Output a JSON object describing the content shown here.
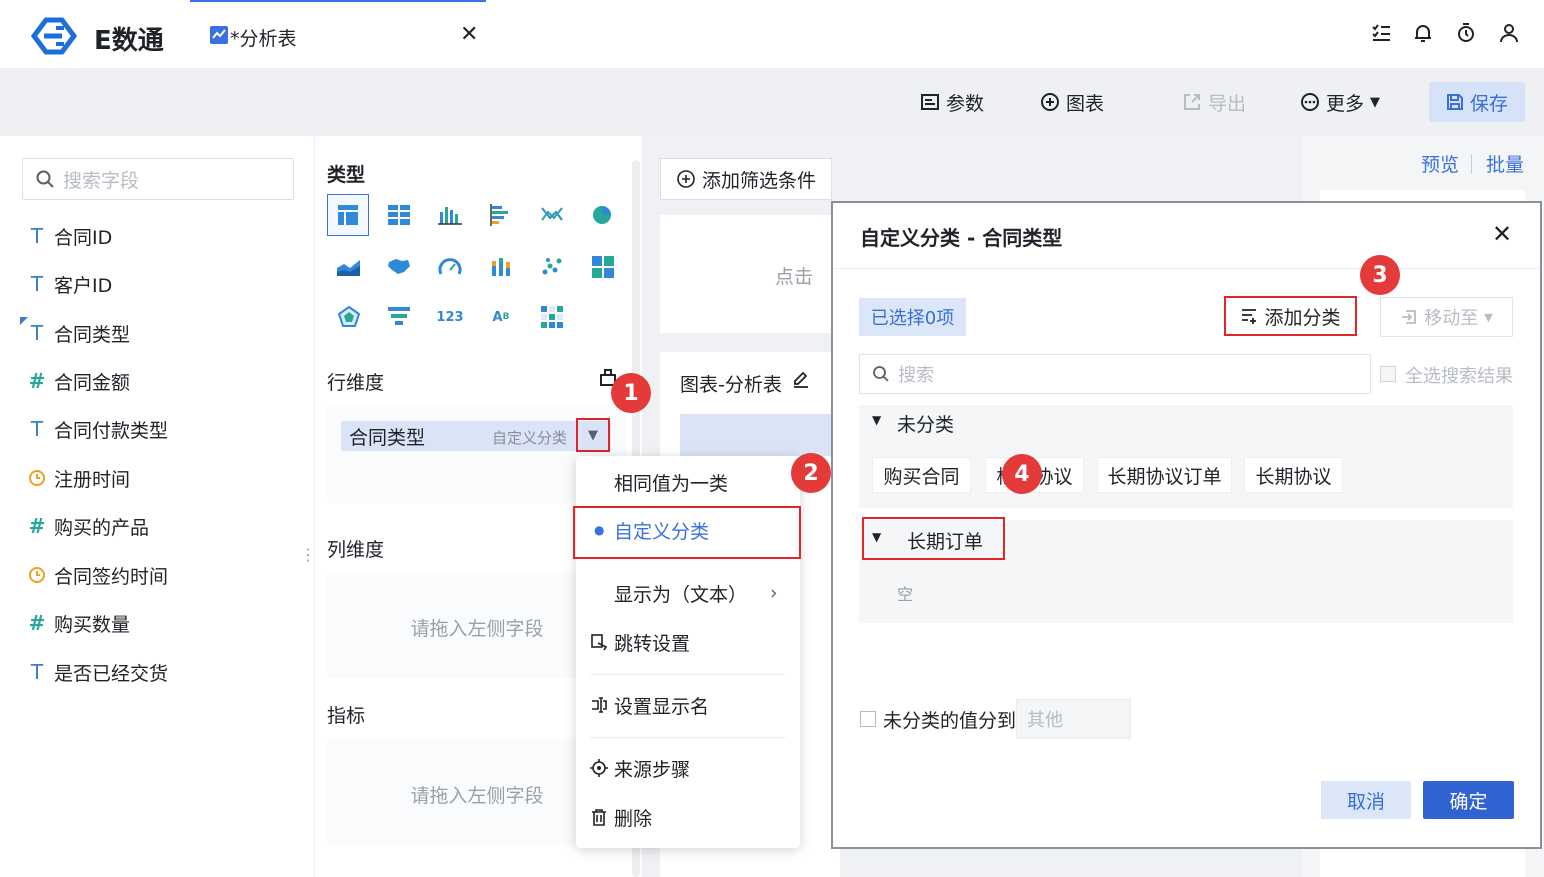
{
  "app": {
    "logo_text": "E数通",
    "tab_title": "*分析表"
  },
  "toolbar": {
    "params": "参数",
    "chart": "图表",
    "export": "导出",
    "more": "更多",
    "save": "保存"
  },
  "fields": {
    "search_placeholder": "搜索字段",
    "items": [
      {
        "label": "合同ID",
        "type": "T"
      },
      {
        "label": "客户ID",
        "type": "T"
      },
      {
        "label": "合同类型",
        "type": "T"
      },
      {
        "label": "合同金额",
        "type": "#"
      },
      {
        "label": "合同付款类型",
        "type": "T"
      },
      {
        "label": "注册时间",
        "type": "date"
      },
      {
        "label": "购买的产品",
        "type": "#"
      },
      {
        "label": "合同签约时间",
        "type": "date"
      },
      {
        "label": "购买数量",
        "type": "#"
      },
      {
        "label": "是否已经交货",
        "type": "T"
      }
    ]
  },
  "config": {
    "type_title": "类型",
    "row_dim": "行维度",
    "col_dim": "列维度",
    "metrics": "指标",
    "pill_label": "合同类型",
    "pill_sub": "自定义分类",
    "drop_hint": "请拖入左侧字段"
  },
  "center": {
    "add_filter": "添加筛选条件",
    "click_hint": "点击",
    "chart_title": "图表-分析表"
  },
  "right": {
    "preview": "预览",
    "batch": "批量"
  },
  "menu": {
    "same_value": "相同值为一类",
    "custom": "自定义分类",
    "display_as": "显示为（文本）",
    "jump": "跳转设置",
    "display_name": "设置显示名",
    "source": "来源步骤",
    "delete": "删除"
  },
  "dialog": {
    "title": "自定义分类 - 合同类型",
    "selected": "已选择0项",
    "add_category": "添加分类",
    "move_to": "移动至",
    "search_placeholder": "搜索",
    "select_all": "全选搜索结果",
    "uncategorized": "未分类",
    "chips": [
      "购买合同",
      "框架协议",
      "长期协议订单",
      "长期协议"
    ],
    "group_name": "长期订单",
    "empty": "空",
    "unassigned_label": "未分类的值分到",
    "unassigned_value": "其他",
    "cancel": "取消",
    "ok": "确定"
  },
  "badges": [
    "1",
    "2",
    "3",
    "4"
  ],
  "colors": {
    "accent": "#3a70e0",
    "highlight": "#e0262b",
    "badge": "#e53a3a"
  }
}
